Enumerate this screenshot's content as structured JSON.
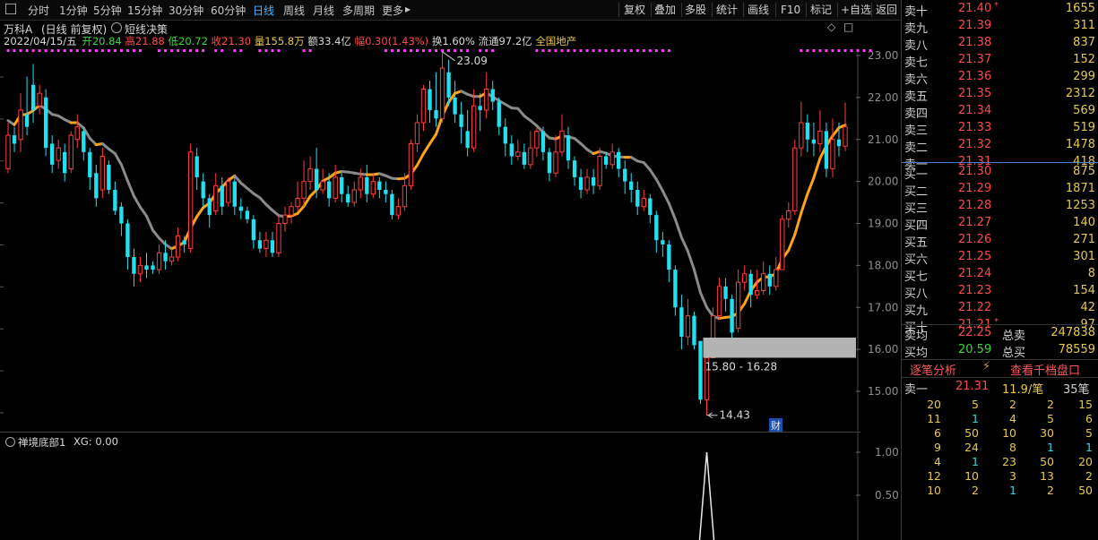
{
  "toolbar": {
    "periods": [
      "分时",
      "1分钟",
      "5分钟",
      "15分钟",
      "30分钟",
      "60分钟",
      "日线",
      "周线",
      "月线",
      "多周期",
      "更多"
    ],
    "active_period": "日线",
    "right_buttons": [
      "复权",
      "叠加",
      "多股",
      "统计",
      "画线",
      "F10",
      "标记",
      "+自选",
      "返回"
    ]
  },
  "stock": {
    "name": "万科A",
    "mode": "(日线 前复权)",
    "indicator": "短线决策"
  },
  "stats": {
    "date": "2022/04/15/五",
    "open_label": "开",
    "open": "20.84",
    "high_label": "高",
    "high": "21.88",
    "low_label": "低",
    "low": "20.72",
    "close_label": "收",
    "close": "21.30",
    "volume_label": "量",
    "volume": "155.8万",
    "amount_label": "额",
    "amount": "33.4亿",
    "change_label": "幅",
    "change": "0.30(1.43%)",
    "turnover_label": "换",
    "turnover": "1.60%",
    "float_label": "流通",
    "float": "97.2亿",
    "sector": "全国地产"
  },
  "chart_data": {
    "type": "candlestick",
    "y_axis_ticks": [
      "23.00",
      "22.00",
      "21.00",
      "20.00",
      "19.00",
      "18.00",
      "17.00",
      "16.00",
      "15.00"
    ],
    "ylim": [
      14.2,
      23.6
    ],
    "annotations": {
      "high": "23.09",
      "low": "14.43",
      "zone": "15.80 - 16.28",
      "cai": "财"
    },
    "zone": [
      15.8,
      16.28
    ],
    "candles": [
      [
        20.3,
        21.1,
        21.4,
        20.2
      ],
      [
        21.1,
        20.9,
        21.3,
        20.7
      ],
      [
        21.0,
        21.7,
        22.1,
        20.7
      ],
      [
        21.6,
        21.3,
        22.5,
        21.1
      ],
      [
        22.3,
        21.7,
        22.8,
        21.4
      ],
      [
        21.8,
        22.1,
        22.3,
        21.6
      ],
      [
        22.0,
        20.8,
        22.2,
        20.6
      ],
      [
        20.9,
        20.4,
        21.1,
        20.2
      ],
      [
        20.5,
        20.8,
        21.0,
        20.3
      ],
      [
        20.7,
        20.2,
        20.9,
        20.0
      ],
      [
        20.3,
        21.1,
        21.2,
        20.2
      ],
      [
        21.0,
        21.3,
        21.6,
        20.8
      ],
      [
        21.2,
        20.7,
        21.3,
        20.5
      ],
      [
        20.7,
        20.1,
        20.8,
        19.8
      ],
      [
        20.2,
        19.6,
        20.4,
        19.4
      ],
      [
        19.8,
        20.6,
        20.8,
        19.6
      ],
      [
        20.4,
        19.8,
        20.5,
        19.7
      ],
      [
        19.8,
        19.3,
        20.0,
        19.2
      ],
      [
        19.4,
        19.0,
        19.5,
        18.7
      ],
      [
        19.0,
        18.2,
        19.1,
        17.9
      ],
      [
        18.2,
        17.8,
        18.4,
        17.5
      ],
      [
        17.8,
        18.0,
        18.2,
        17.6
      ],
      [
        18.0,
        17.9,
        18.3,
        17.7
      ],
      [
        18.0,
        17.9,
        18.1,
        17.8
      ],
      [
        17.9,
        18.3,
        18.5,
        17.8
      ],
      [
        18.3,
        18.1,
        18.6,
        17.9
      ],
      [
        18.1,
        18.2,
        18.4,
        18.0
      ],
      [
        18.2,
        18.7,
        18.9,
        18.1
      ],
      [
        18.6,
        18.5,
        18.7,
        18.3
      ],
      [
        18.4,
        20.7,
        20.9,
        18.3
      ],
      [
        20.6,
        20.1,
        20.8,
        19.8
      ],
      [
        20.0,
        19.6,
        20.2,
        19.4
      ],
      [
        19.6,
        19.2,
        19.7,
        18.9
      ],
      [
        19.3,
        19.9,
        20.2,
        19.2
      ],
      [
        19.9,
        19.4,
        20.1,
        19.2
      ],
      [
        19.5,
        20.0,
        20.1,
        19.4
      ],
      [
        20.0,
        19.4,
        20.1,
        19.2
      ],
      [
        19.4,
        19.3,
        19.6,
        19.1
      ],
      [
        19.3,
        19.1,
        19.4,
        19.0
      ],
      [
        19.1,
        18.6,
        19.2,
        18.4
      ],
      [
        18.6,
        18.4,
        18.8,
        18.3
      ],
      [
        18.4,
        18.6,
        18.8,
        18.2
      ],
      [
        18.6,
        18.3,
        18.8,
        18.2
      ],
      [
        18.3,
        19.0,
        19.2,
        18.2
      ],
      [
        19.0,
        19.2,
        19.4,
        18.8
      ],
      [
        19.2,
        19.4,
        19.5,
        19.0
      ],
      [
        19.4,
        19.6,
        20.0,
        19.3
      ],
      [
        19.6,
        20.0,
        20.5,
        19.4
      ],
      [
        20.0,
        20.3,
        20.6,
        19.8
      ],
      [
        20.3,
        19.8,
        20.8,
        19.6
      ],
      [
        19.8,
        20.0,
        20.3,
        19.7
      ],
      [
        20.0,
        19.6,
        20.2,
        19.4
      ],
      [
        19.6,
        20.1,
        20.4,
        19.5
      ],
      [
        20.1,
        19.7,
        20.2,
        19.5
      ],
      [
        19.7,
        19.5,
        19.9,
        19.4
      ],
      [
        19.5,
        19.8,
        20.0,
        19.4
      ],
      [
        19.8,
        20.1,
        20.3,
        19.6
      ],
      [
        20.1,
        19.7,
        20.4,
        19.5
      ],
      [
        19.7,
        20.0,
        20.2,
        19.6
      ],
      [
        20.0,
        19.8,
        20.1,
        19.6
      ],
      [
        19.8,
        19.7,
        20.0,
        19.5
      ],
      [
        19.7,
        19.2,
        19.8,
        19.1
      ],
      [
        19.2,
        19.4,
        19.6,
        19.1
      ],
      [
        19.4,
        19.9,
        20.2,
        19.3
      ],
      [
        19.9,
        20.9,
        21.0,
        19.8
      ],
      [
        20.9,
        21.4,
        21.6,
        20.7
      ],
      [
        21.4,
        22.2,
        22.3,
        21.2
      ],
      [
        22.2,
        21.7,
        22.4,
        21.4
      ],
      [
        21.7,
        21.5,
        22.6,
        21.3
      ],
      [
        21.5,
        22.7,
        23.09,
        21.4
      ],
      [
        22.6,
        22.0,
        22.9,
        21.8
      ],
      [
        22.0,
        21.6,
        22.4,
        21.4
      ],
      [
        21.6,
        21.3,
        21.9,
        20.9
      ],
      [
        21.2,
        20.8,
        21.7,
        20.6
      ],
      [
        20.8,
        21.8,
        22.2,
        20.7
      ],
      [
        21.8,
        21.7,
        22.1,
        21.2
      ],
      [
        21.7,
        22.2,
        22.6,
        21.5
      ],
      [
        22.2,
        21.9,
        22.4,
        21.7
      ],
      [
        21.9,
        21.3,
        22.0,
        21.1
      ],
      [
        21.3,
        20.9,
        21.5,
        20.6
      ],
      [
        20.9,
        20.6,
        21.1,
        20.4
      ],
      [
        20.6,
        20.7,
        21.0,
        20.5
      ],
      [
        20.7,
        20.4,
        20.9,
        20.3
      ],
      [
        20.4,
        20.8,
        21.2,
        20.3
      ],
      [
        20.8,
        21.2,
        21.3,
        20.6
      ],
      [
        21.2,
        20.7,
        21.3,
        20.5
      ],
      [
        20.7,
        20.2,
        20.8,
        20.0
      ],
      [
        20.2,
        20.7,
        21.1,
        20.1
      ],
      [
        20.7,
        21.2,
        21.6,
        20.6
      ],
      [
        21.1,
        20.5,
        21.3,
        20.3
      ],
      [
        20.5,
        20.1,
        20.6,
        19.9
      ],
      [
        20.1,
        19.8,
        20.3,
        19.6
      ],
      [
        19.8,
        20.1,
        20.3,
        19.7
      ],
      [
        20.1,
        19.9,
        20.3,
        19.7
      ],
      [
        19.9,
        20.6,
        20.8,
        19.8
      ],
      [
        20.6,
        20.4,
        20.7,
        20.3
      ],
      [
        20.4,
        20.7,
        20.9,
        20.3
      ],
      [
        20.7,
        20.3,
        20.8,
        20.1
      ],
      [
        20.3,
        20.0,
        20.5,
        19.7
      ],
      [
        20.0,
        19.8,
        20.2,
        19.5
      ],
      [
        19.8,
        19.4,
        20.0,
        19.2
      ],
      [
        19.4,
        19.6,
        19.8,
        19.3
      ],
      [
        19.6,
        19.2,
        19.7,
        19.0
      ],
      [
        19.2,
        18.6,
        19.3,
        18.3
      ],
      [
        18.6,
        18.5,
        18.8,
        18.2
      ],
      [
        18.5,
        17.9,
        18.6,
        17.6
      ],
      [
        17.9,
        17.0,
        18.0,
        16.8
      ],
      [
        17.0,
        16.3,
        17.3,
        16.0
      ],
      [
        16.3,
        16.8,
        17.2,
        16.1
      ],
      [
        16.8,
        16.1,
        16.9,
        16.0
      ],
      [
        16.2,
        14.8,
        16.2,
        14.7
      ],
      [
        14.8,
        15.8,
        16.0,
        14.43
      ],
      [
        15.8,
        16.8,
        17.0,
        15.8
      ],
      [
        16.8,
        17.5,
        17.7,
        16.7
      ],
      [
        17.5,
        17.2,
        17.7,
        16.9
      ],
      [
        17.2,
        16.4,
        17.3,
        16.2
      ],
      [
        16.5,
        17.6,
        17.9,
        16.4
      ],
      [
        17.6,
        17.8,
        18.0,
        17.4
      ],
      [
        17.8,
        17.3,
        17.9,
        17.0
      ],
      [
        17.3,
        17.4,
        17.9,
        17.2
      ],
      [
        17.4,
        17.8,
        18.1,
        17.3
      ],
      [
        17.8,
        17.5,
        18.0,
        17.3
      ],
      [
        17.5,
        17.9,
        18.2,
        17.4
      ],
      [
        17.9,
        19.1,
        19.2,
        17.9
      ],
      [
        19.1,
        19.3,
        19.5,
        18.9
      ],
      [
        19.3,
        20.8,
        21.0,
        19.2
      ],
      [
        20.8,
        21.4,
        21.9,
        20.6
      ],
      [
        21.4,
        21.0,
        21.6,
        20.7
      ],
      [
        21.0,
        20.9,
        21.4,
        20.6
      ],
      [
        20.9,
        21.2,
        21.7,
        20.7
      ],
      [
        21.2,
        20.3,
        21.4,
        20.1
      ],
      [
        20.3,
        21.0,
        21.5,
        20.1
      ],
      [
        21.0,
        20.84,
        21.4,
        20.6
      ],
      [
        20.84,
        21.3,
        21.88,
        20.72
      ]
    ],
    "signal_indices": [
      0,
      1,
      2,
      3,
      4,
      5,
      6,
      7,
      8,
      9,
      10,
      11,
      12,
      13,
      14,
      15,
      16,
      17,
      18,
      19,
      20,
      21,
      24,
      25,
      26,
      27,
      28,
      29,
      30,
      31,
      33,
      34,
      36,
      37,
      40,
      41,
      42,
      43,
      47,
      48,
      60,
      61,
      62,
      63,
      64,
      65,
      66,
      67,
      68,
      69,
      70,
      71,
      72,
      73,
      75,
      76,
      77,
      84,
      85,
      86,
      87,
      88,
      89,
      90,
      91,
      92,
      93,
      94,
      95,
      96,
      97,
      98,
      99,
      100,
      101,
      102,
      103,
      104,
      105,
      126,
      127,
      128,
      129,
      130,
      131,
      132,
      133,
      134,
      135,
      136,
      137
    ]
  },
  "indicator_panel": {
    "name": "禅境底部1",
    "xg": "XG: 0.00",
    "ticks": [
      "1.00",
      "0.50"
    ],
    "spike_index": 111,
    "spike_value": 1.0
  },
  "orderbook": {
    "asks": [
      {
        "label": "卖十",
        "price": "21.40",
        "vol": "1655",
        "mark": "*"
      },
      {
        "label": "卖九",
        "price": "21.39",
        "vol": "311"
      },
      {
        "label": "卖八",
        "price": "21.38",
        "vol": "837"
      },
      {
        "label": "卖七",
        "price": "21.37",
        "vol": "152"
      },
      {
        "label": "卖六",
        "price": "21.36",
        "vol": "299"
      },
      {
        "label": "卖五",
        "price": "21.35",
        "vol": "2312"
      },
      {
        "label": "卖四",
        "price": "21.34",
        "vol": "569"
      },
      {
        "label": "卖三",
        "price": "21.33",
        "vol": "519"
      },
      {
        "label": "卖二",
        "price": "21.32",
        "vol": "1478"
      },
      {
        "label": "卖一",
        "price": "21.31",
        "vol": "418"
      }
    ],
    "bids": [
      {
        "label": "买一",
        "price": "21.30",
        "vol": "875"
      },
      {
        "label": "买二",
        "price": "21.29",
        "vol": "1871"
      },
      {
        "label": "买三",
        "price": "21.28",
        "vol": "1253"
      },
      {
        "label": "买四",
        "price": "21.27",
        "vol": "140"
      },
      {
        "label": "买五",
        "price": "21.26",
        "vol": "271"
      },
      {
        "label": "买六",
        "price": "21.25",
        "vol": "301"
      },
      {
        "label": "买七",
        "price": "21.24",
        "vol": "8"
      },
      {
        "label": "买八",
        "price": "21.23",
        "vol": "154"
      },
      {
        "label": "买九",
        "price": "21.22",
        "vol": "42"
      },
      {
        "label": "买十",
        "price": "21.21",
        "vol": "97",
        "mark": "*"
      }
    ],
    "avg_sell_label": "卖均",
    "avg_sell": "22.25",
    "total_sell_label": "总卖",
    "total_sell": "247838",
    "avg_buy_label": "买均",
    "avg_buy": "20.59",
    "total_buy_label": "总买",
    "total_buy": "78559",
    "tick_analysis": "逐笔分析",
    "view_depth": "查看千档盘口",
    "sell1_label": "卖一",
    "sell1_price": "21.31",
    "sell1_vol": "11.9/笔",
    "sell1_count": "35笔",
    "queue": [
      [
        "20",
        "5",
        "2",
        "2",
        "15"
      ],
      [
        "11",
        "1",
        "4",
        "5",
        "6"
      ],
      [
        "6",
        "50",
        "10",
        "30",
        "5"
      ],
      [
        "9",
        "24",
        "8",
        "1",
        "1"
      ],
      [
        "4",
        "1",
        "23",
        "50",
        "20"
      ],
      [
        "12",
        "10",
        "3",
        "13",
        "2"
      ],
      [
        "10",
        "2",
        "1",
        "2",
        "50"
      ]
    ]
  },
  "colors": {
    "up": "#ff3c3c",
    "down": "#22e0f0",
    "ma_orange": "#ffa31a",
    "ma_gray": "#8a8a8a",
    "signal": "#ff3cff",
    "zone": "#b3b3b3"
  }
}
